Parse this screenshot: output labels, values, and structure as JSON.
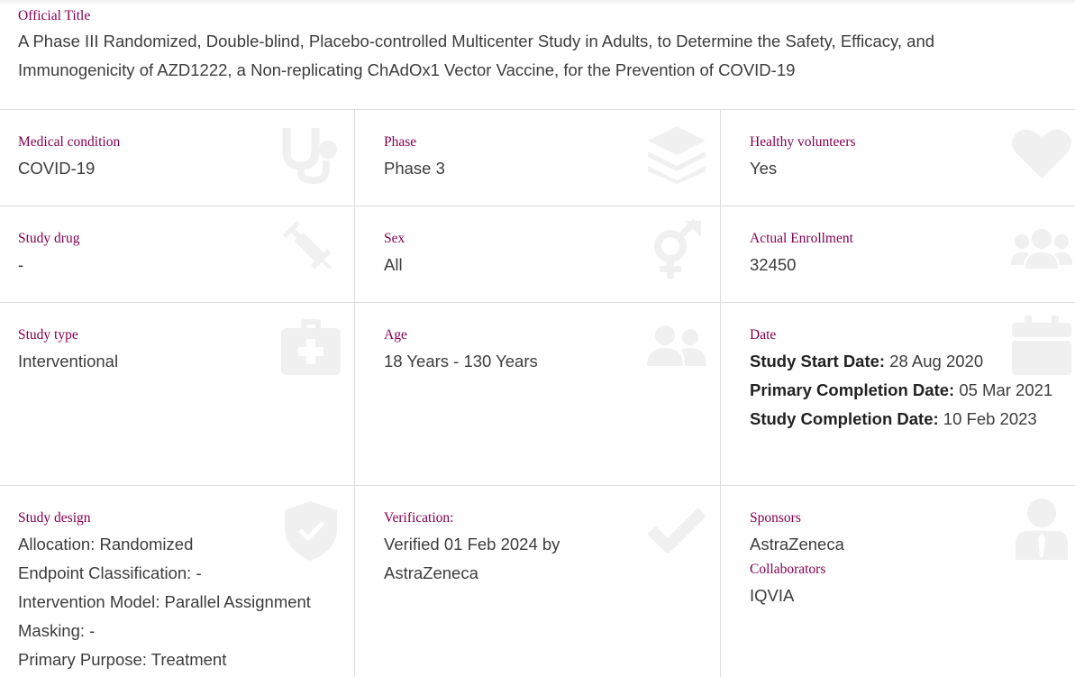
{
  "official_title": {
    "label": "Official Title",
    "value": "A Phase III Randomized, Double-blind, Placebo-controlled Multicenter Study in Adults, to Determine the Safety, Efficacy, and Immunogenicity of AZD1222, a Non-replicating ChAdOx1 Vector Vaccine, for the Prevention of COVID-19"
  },
  "medical_condition": {
    "label": "Medical condition",
    "value": "COVID-19",
    "icon": "stethoscope-icon"
  },
  "phase": {
    "label": "Phase",
    "value": "Phase 3",
    "icon": "layers-icon"
  },
  "healthy_volunteers": {
    "label": "Healthy volunteers",
    "value": "Yes",
    "icon": "heart-icon"
  },
  "study_drug": {
    "label": "Study drug",
    "value": "-",
    "icon": "syringe-icon"
  },
  "sex": {
    "label": "Sex",
    "value": "All",
    "icon": "gender-icon"
  },
  "actual_enrollment": {
    "label": "Actual Enrollment",
    "value": "32450",
    "icon": "group-icon"
  },
  "study_type": {
    "label": "Study type",
    "value": "Interventional",
    "icon": "medical-kit-icon"
  },
  "age": {
    "label": "Age",
    "value": "18 Years - 130 Years",
    "icon": "users-icon"
  },
  "date": {
    "label": "Date",
    "icon": "calendar-icon",
    "start_label": "Study Start Date:",
    "start_value": " 28 Aug 2020",
    "primary_label": "Primary Completion Date:",
    "primary_value": " 05 Mar 2021",
    "completion_label": "Study Completion Date:",
    "completion_value": " 10 Feb 2023"
  },
  "study_design": {
    "label": "Study design",
    "icon": "shield-check-icon",
    "lines": [
      "Allocation: Randomized",
      "Endpoint Classification: -",
      "Intervention Model: Parallel Assignment",
      "Masking: -",
      "Primary Purpose: Treatment"
    ]
  },
  "verification": {
    "label": "Verification:",
    "value": "Verified 01 Feb 2024 by AstraZeneca",
    "icon": "checkmark-icon"
  },
  "sponsors": {
    "label": "Sponsors",
    "value": "AstraZeneca",
    "collaborators_label": "Collaborators",
    "collaborators_value": "IQVIA",
    "icon": "person-tie-icon"
  },
  "colors": {
    "label": "#830051",
    "text": "#3c3c3c",
    "icon": "#f0f0f0",
    "divider": "#dddddd"
  }
}
